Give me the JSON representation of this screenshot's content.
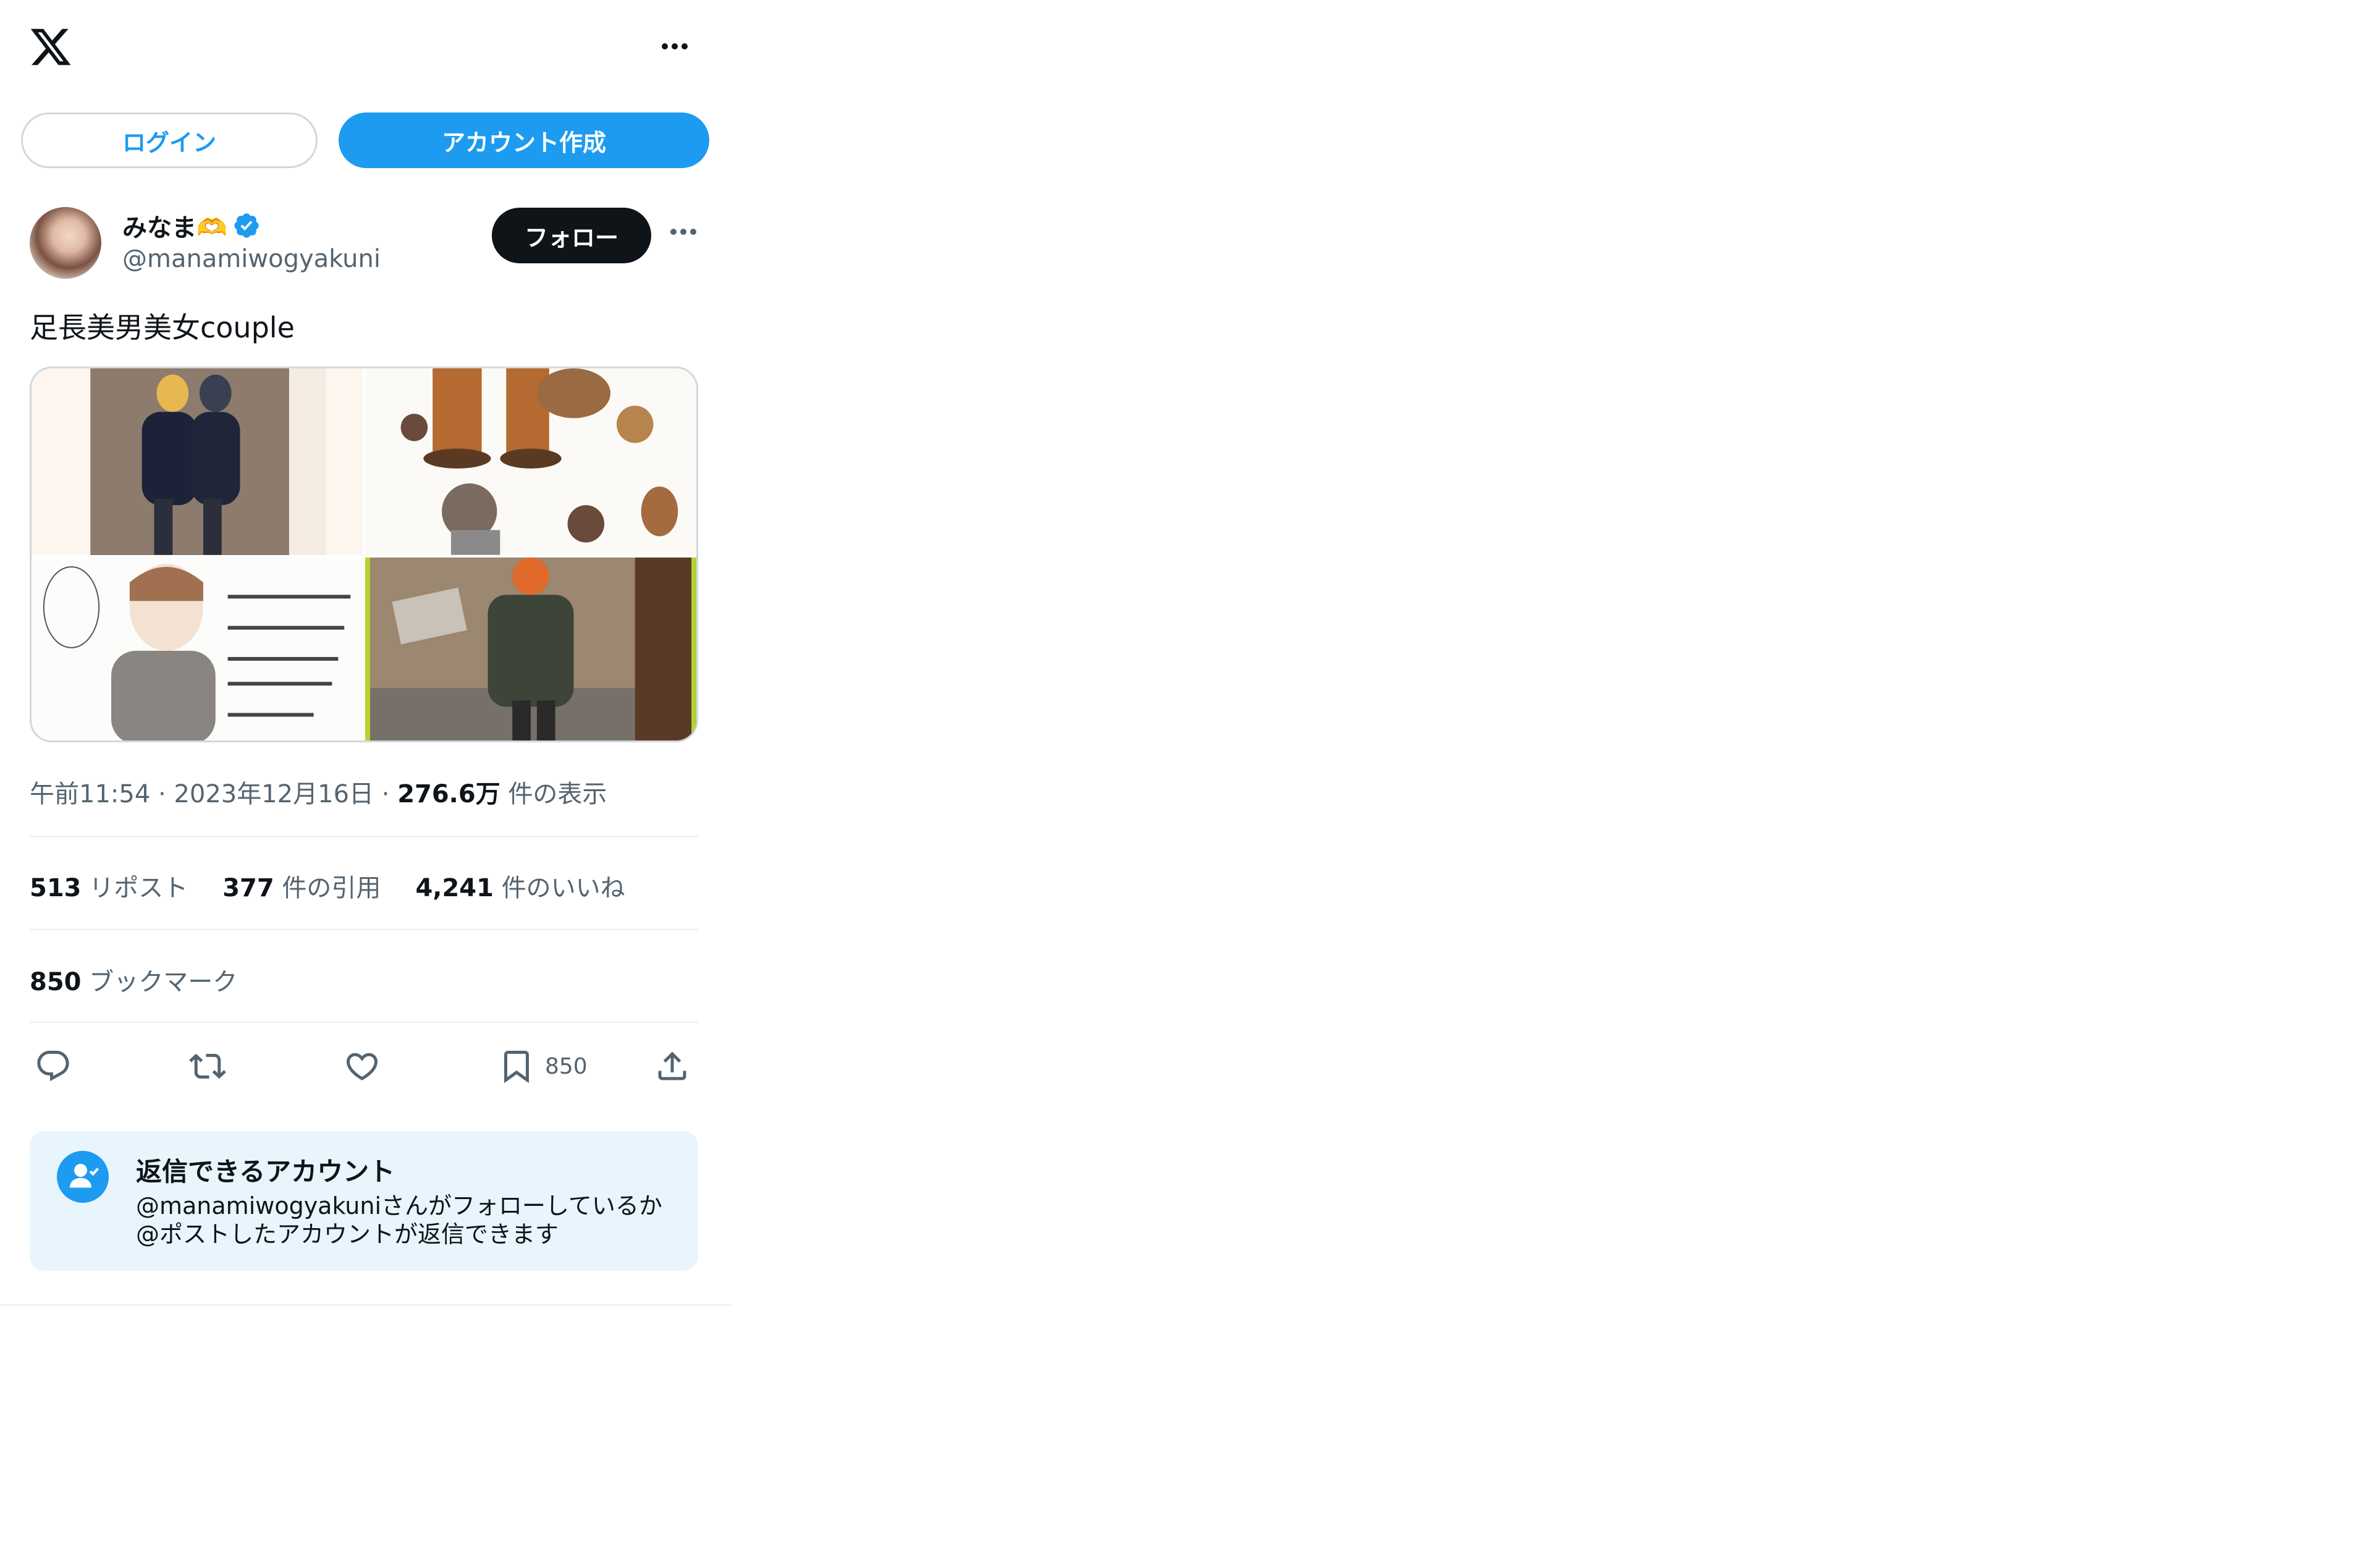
{
  "header": {
    "logo_icon": "x-logo-icon",
    "more_icon": "more-horizontal-icon"
  },
  "auth": {
    "login_label": "ログイン",
    "signup_label": "アカウント作成"
  },
  "author": {
    "name": "みなま🫶",
    "handle": "@manamiwogyakuni",
    "follow_label": "フォロー"
  },
  "tweet": {
    "text": "足長美男美女couple",
    "time": "午前11:54",
    "date": "2023年12月16日",
    "views_count": "276.6万",
    "views_label": "件の表示"
  },
  "stats": {
    "reposts_count": "513",
    "reposts_label": "リポスト",
    "quotes_count": "377",
    "quotes_label": "件の引用",
    "likes_count": "4,241",
    "likes_label": "件のいいね",
    "bookmarks_count": "850",
    "bookmarks_label": "ブックマーク"
  },
  "actions": {
    "bookmark_count": "850"
  },
  "reply_info": {
    "title": "返信できるアカウント",
    "description": "@manamiwogyakuniさんがフォローしているか@ポストしたアカウントが返信できます"
  },
  "colors": {
    "accent": "#1d9bf0",
    "text": "#0f1419",
    "secondary": "#536471"
  }
}
